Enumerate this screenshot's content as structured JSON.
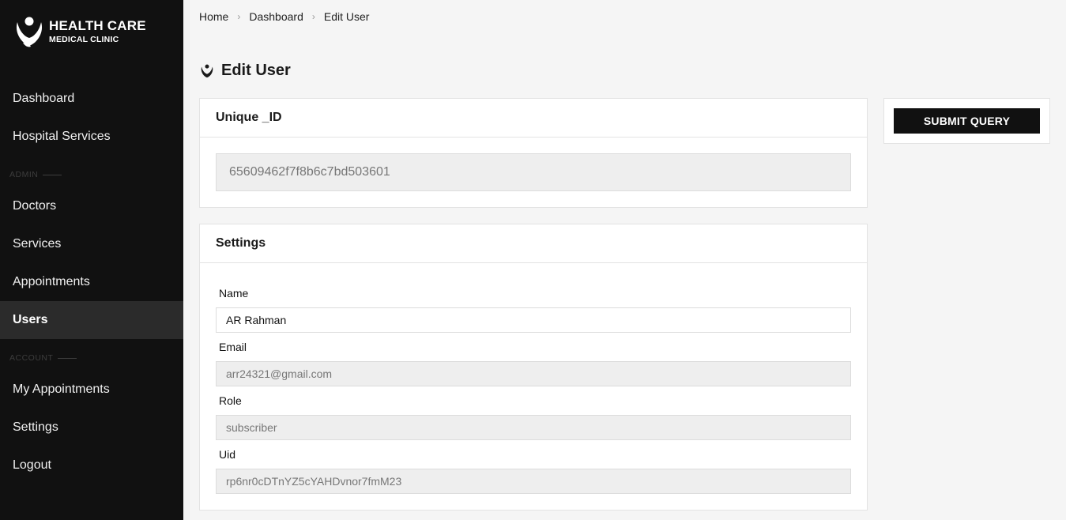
{
  "brand": {
    "title": "HEALTH CARE",
    "subtitle": "MEDICAL CLINIC"
  },
  "sidebar": {
    "items": [
      {
        "label": "Dashboard"
      },
      {
        "label": "Hospital Services"
      },
      {
        "label": "Doctors"
      },
      {
        "label": "Services"
      },
      {
        "label": "Appointments"
      },
      {
        "label": "Users",
        "active": true
      },
      {
        "label": "My Appointments"
      },
      {
        "label": "Settings"
      },
      {
        "label": "Logout"
      }
    ],
    "sections": {
      "admin": "ADMIN",
      "account": "ACCOUNT"
    }
  },
  "breadcrumb": [
    "Home",
    "Dashboard",
    "Edit User"
  ],
  "page": {
    "title": "Edit User"
  },
  "unique_card": {
    "title": "Unique _ID",
    "value": "65609462f7f8b6c7bd503601"
  },
  "settings_card": {
    "title": "Settings",
    "fields": {
      "name": {
        "label": "Name",
        "value": "AR Rahman"
      },
      "email": {
        "label": "Email",
        "value": "arr24321@gmail.com"
      },
      "role": {
        "label": "Role",
        "value": "subscriber"
      },
      "uid": {
        "label": "Uid",
        "value": "rp6nr0cDTnYZ5cYAHDvnor7fmM23"
      }
    }
  },
  "actions": {
    "submit_label": "SUBMIT QUERY"
  },
  "colors": {
    "sidebar_bg": "#111111",
    "active_item_bg": "#2b2b2b",
    "page_bg": "#f5f5f5",
    "button_bg": "#111111"
  }
}
